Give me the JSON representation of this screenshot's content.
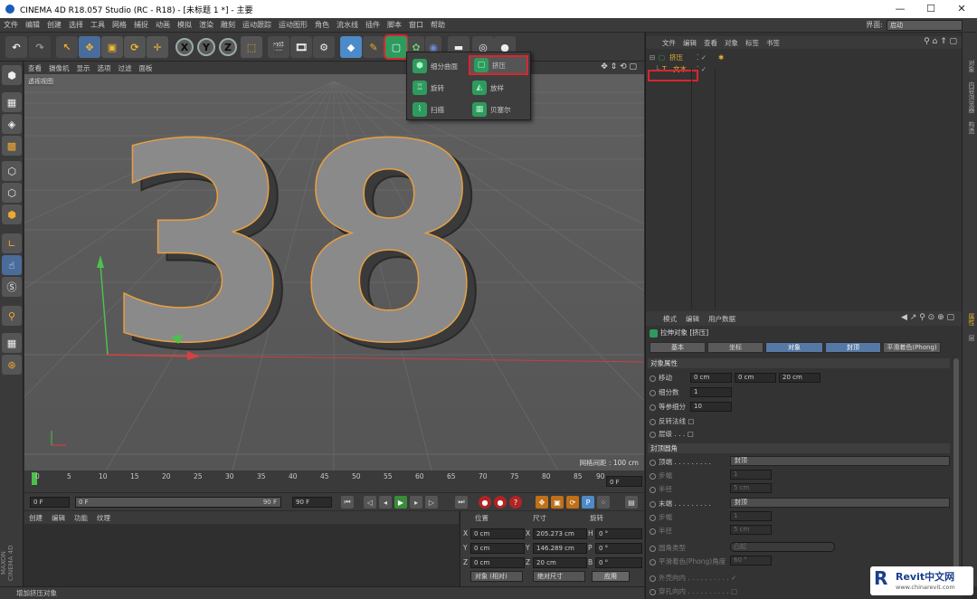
{
  "window": {
    "title": "CINEMA 4D R18.057 Studio (RC - R18) - [未标题 1 *] - 主要"
  },
  "menubar": {
    "items": [
      "文件",
      "编辑",
      "创建",
      "选择",
      "工具",
      "网格",
      "捕捉",
      "动画",
      "模拟",
      "渲染",
      "雕刻",
      "运动跟踪",
      "运动图形",
      "角色",
      "流水线",
      "插件",
      "脚本",
      "窗口",
      "帮助"
    ],
    "layout_label": "界面:",
    "layout_value": "启动"
  },
  "viewport": {
    "menu": [
      "查看",
      "摄像机",
      "显示",
      "选项",
      "过滤",
      "面板"
    ],
    "label": "透视视图",
    "grid_label": "网格间距 : 100 cm",
    "text_object": "38"
  },
  "dropdown": {
    "items": [
      "细分曲面",
      "挤压",
      "旋转",
      "放样",
      "扫描",
      "贝塞尔"
    ]
  },
  "timeline": {
    "ticks": [
      "0",
      "5",
      "10",
      "15",
      "20",
      "25",
      "30",
      "35",
      "40",
      "45",
      "50",
      "55",
      "60",
      "65",
      "70",
      "75",
      "80",
      "85",
      "90"
    ],
    "frame_end": "0 F",
    "start_field": "0 F",
    "range_start": "0 F",
    "range_end": "90 F",
    "end_field": "90 F"
  },
  "materials": {
    "menu": [
      "创建",
      "编辑",
      "功能",
      "纹理"
    ]
  },
  "coords": {
    "headers": [
      "位置",
      "尺寸",
      "旋转"
    ],
    "rows": [
      {
        "axis": "X",
        "pos": "0 cm",
        "size_axis": "X",
        "size": "205.273 cm",
        "rot_axis": "H",
        "rot": "0 °"
      },
      {
        "axis": "Y",
        "pos": "0 cm",
        "size_axis": "Y",
        "size": "146.289 cm",
        "rot_axis": "P",
        "rot": "0 °"
      },
      {
        "axis": "Z",
        "pos": "0 cm",
        "size_axis": "Z",
        "size": "20 cm",
        "rot_axis": "B",
        "rot": "0 °"
      }
    ],
    "mode_select": "对象 (相对)",
    "size_select": "绝对尺寸",
    "apply": "应用"
  },
  "statusbar": {
    "text": "增加挤压对象"
  },
  "object_manager": {
    "menu": [
      "文件",
      "编辑",
      "查看",
      "对象",
      "标签",
      "书签"
    ],
    "objects": [
      {
        "name": "挤压",
        "color": "#e8b030"
      },
      {
        "name": "文本",
        "color": "#e8b030"
      }
    ]
  },
  "attribute_manager": {
    "menu": [
      "模式",
      "编辑",
      "用户数据"
    ],
    "title": "拉伸对象 [挤压]",
    "tabs": [
      "基本",
      "坐标",
      "对象",
      "封顶",
      "平滑着色(Phong)"
    ],
    "section_object": "对象属性",
    "move_label": "移动",
    "move_x": "0 cm",
    "move_y": "0 cm",
    "move_z": "20 cm",
    "subdiv_label": "细分数",
    "subdiv_value": "1",
    "iso_label": "等参细分",
    "iso_value": "10",
    "flip_label": "反转法线",
    "layer_label": "层级",
    "section_caps": "封顶圆角",
    "top_label": "顶端",
    "top_value": "封顶",
    "step1_label": "步幅",
    "step1_value": "1",
    "radius1_label": "半径",
    "radius1_value": "5 cm",
    "end_label": "末端",
    "end_value": "封顶",
    "step2_label": "步幅",
    "step2_value": "1",
    "radius2_label": "半径",
    "radius2_value": "5 cm",
    "fillet_type_label": "圆角类型",
    "fillet_type_value": "凸起",
    "phong_label": "平滑着色(Phong)角度",
    "phong_value": "60 °",
    "outward_label": "外壳向内",
    "hole_label": "穿孔向内"
  },
  "right_tabs": [
    "对象",
    "内容浏览器",
    "构造",
    "属性",
    "层"
  ],
  "watermark": {
    "brand": "Revit中文网",
    "url": "www.chinarevit.com"
  },
  "colors": {
    "accent_blue": "#5678a5",
    "highlight_red": "#d8262d",
    "spline_orange": "#e8a040"
  }
}
